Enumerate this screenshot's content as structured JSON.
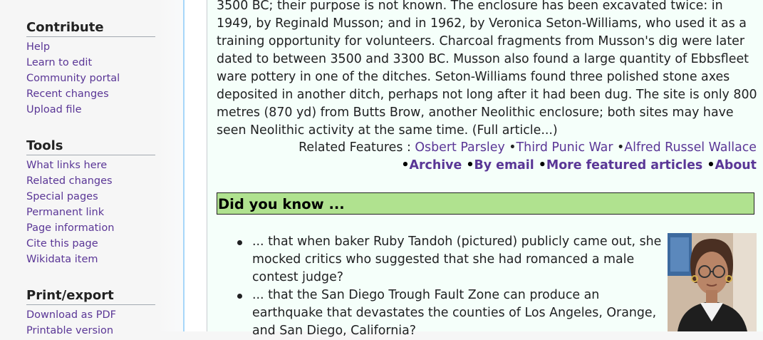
{
  "sidebar": {
    "contribute": {
      "heading": "Contribute",
      "items": [
        "Help",
        "Learn to edit",
        "Community portal",
        "Recent changes",
        "Upload file"
      ]
    },
    "tools": {
      "heading": "Tools",
      "items": [
        "What links here",
        "Related changes",
        "Special pages",
        "Permanent link",
        "Page information",
        "Cite this page",
        "Wikidata item"
      ]
    },
    "print": {
      "heading": "Print/export",
      "items": [
        "Download as PDF",
        "Printable version"
      ]
    }
  },
  "article": {
    "text": "3500 BC; their purpose is not known. The enclosure has been excavated twice: in 1949, by Reginald Musson; and in 1962, by Veronica Seton-Williams, who used it as a training opportunity for volunteers. Charcoal fragments from Musson's dig were later dated to between 3500 and 3300 BC. Musson also found a large quantity of Ebbsfleet ware pottery in one of the ditches. Seton-Williams found three polished stone axes deposited in another ditch, perhaps not long after it had been dug. The site is only 800 metres (870 yd) from Butts Brow, another Neolithic enclosure; both sites may have seen Neolithic activity at the same time. (Full article...)",
    "related_label": "Related Features :",
    "related": [
      "Osbert Parsley",
      "Third Punic War",
      "Alfred Russel Wallace"
    ],
    "links": [
      "Archive",
      "By email",
      "More featured articles",
      "About"
    ]
  },
  "dyk": {
    "heading": "Did you know ...",
    "items": [
      "... that when baker Ruby Tandoh (pictured) publicly came out, she mocked critics who suggested that she had romanced a male contest judge?",
      "... that the San Diego Trough Fault Zone can produce an earthquake that devastates the counties of Los Angeles, Orange, and San Diego, California?"
    ]
  },
  "colors": {
    "link": "#5a3696",
    "dyk_heading_bg": "#b0e28f",
    "box_bg": "#f5fffa",
    "sidebar_divider": "#a7d7f9"
  }
}
